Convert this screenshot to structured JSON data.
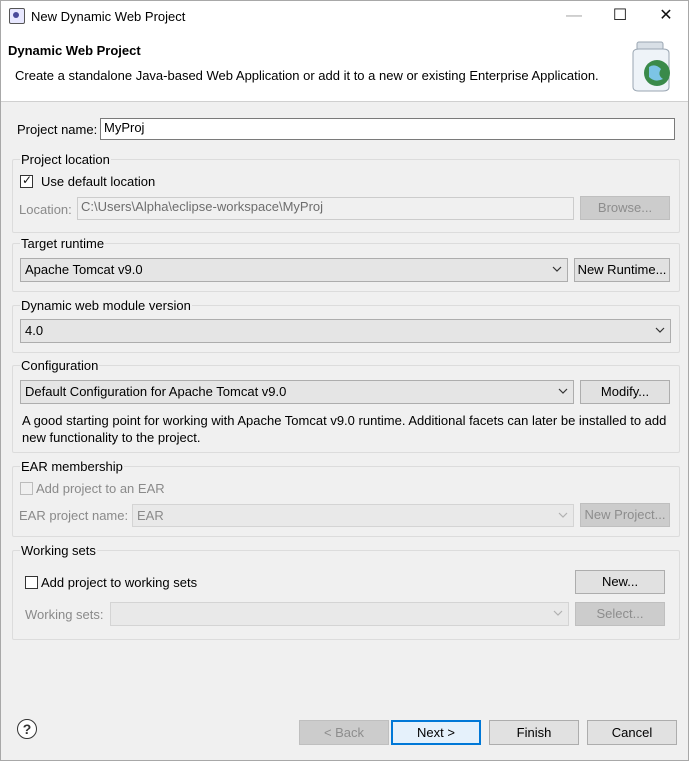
{
  "window": {
    "title": "New Dynamic Web Project",
    "minimize_glyph": "—",
    "maximize_glyph": "☐",
    "close_glyph": "✕"
  },
  "header": {
    "title": "Dynamic Web Project",
    "description": "Create a standalone Java-based Web Application or add it to a new or existing Enterprise Application."
  },
  "project_name": {
    "label": "Project name:",
    "value": "MyProj"
  },
  "project_location": {
    "group_label": "Project location",
    "use_default_label": "Use default location",
    "use_default_checked": true,
    "location_label": "Location:",
    "location_value": "C:\\Users\\Alpha\\eclipse-workspace\\MyProj",
    "browse_label": "Browse..."
  },
  "target_runtime": {
    "group_label": "Target runtime",
    "selected": "Apache Tomcat v9.0",
    "new_runtime_label": "New Runtime..."
  },
  "module_version": {
    "group_label": "Dynamic web module version",
    "selected": "4.0"
  },
  "configuration": {
    "group_label": "Configuration",
    "selected": "Default Configuration for Apache Tomcat v9.0",
    "modify_label": "Modify...",
    "description": "A good starting point for working with Apache Tomcat v9.0 runtime. Additional facets can later be installed to add new functionality to the project."
  },
  "ear_membership": {
    "group_label": "EAR membership",
    "add_label": "Add project to an EAR",
    "ear_name_label": "EAR project name:",
    "ear_name_value": "EAR",
    "new_project_label": "New Project..."
  },
  "working_sets": {
    "group_label": "Working sets",
    "add_label": "Add project to working sets",
    "new_label": "New...",
    "sets_label": "Working sets:",
    "select_label": "Select..."
  },
  "footer": {
    "help_glyph": "?",
    "back_label": "< Back",
    "next_label": "Next >",
    "finish_label": "Finish",
    "cancel_label": "Cancel"
  }
}
